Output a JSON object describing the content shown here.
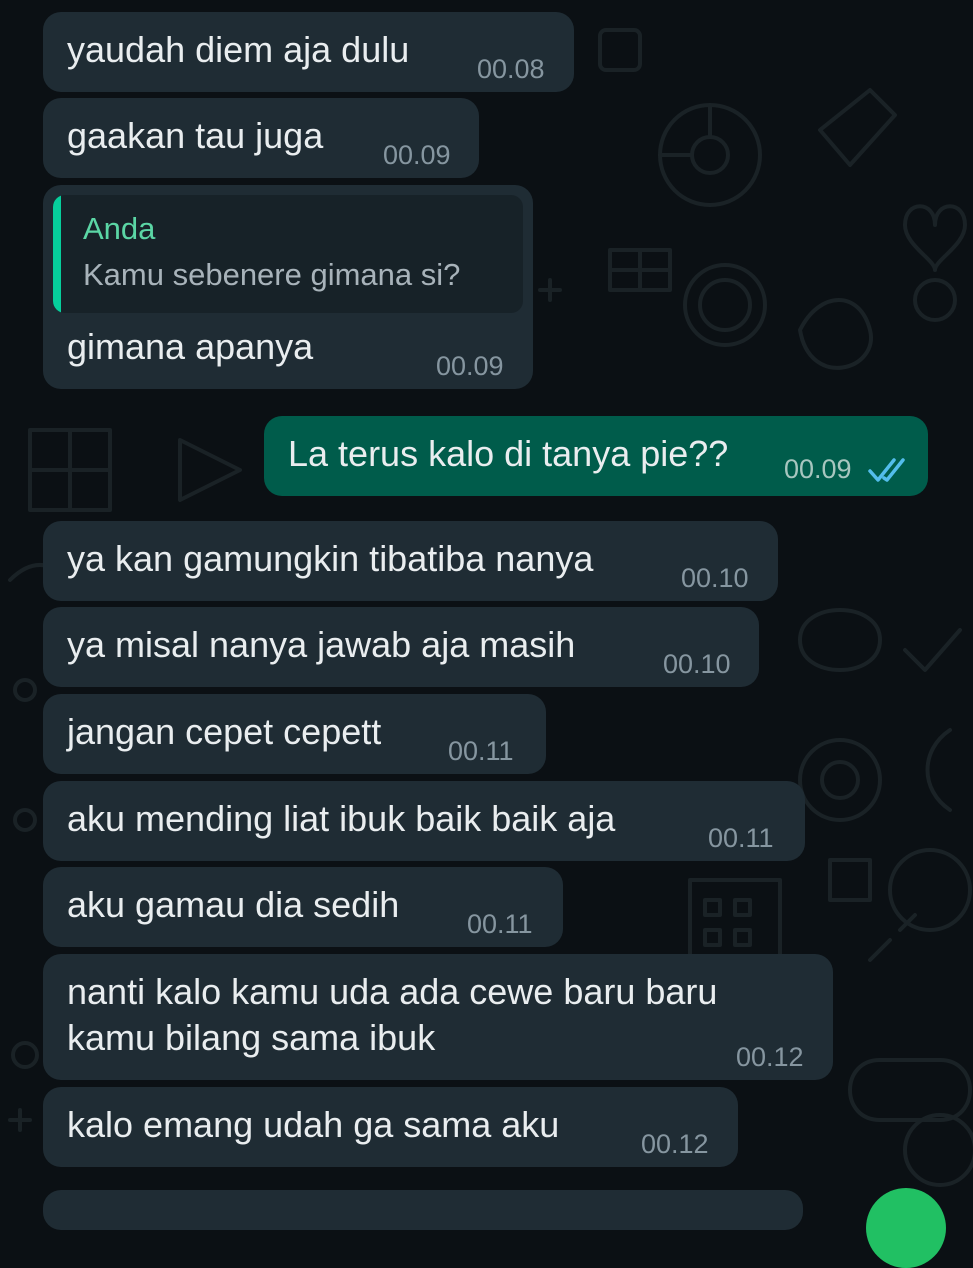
{
  "colors": {
    "background": "#0b1014",
    "incoming_bubble": "#1f2c34",
    "outgoing_bubble": "#005c4b",
    "quote_accent": "#06cf9c",
    "quote_sender": "#5bd6a5",
    "read_tick": "#53bdeb"
  },
  "messages": [
    {
      "direction": "incoming",
      "text": "yaudah diem aja dulu",
      "time": "00.08"
    },
    {
      "direction": "incoming",
      "text": "gaakan tau juga",
      "time": "00.09"
    },
    {
      "direction": "incoming",
      "text": "gimana apanya",
      "time": "00.09",
      "quote": {
        "sender": "Anda",
        "text": "Kamu sebenere gimana si?"
      }
    },
    {
      "direction": "outgoing",
      "text": "La terus kalo di tanya pie??",
      "time": "00.09",
      "status": "read",
      "status_icon": "double-check-icon"
    },
    {
      "direction": "incoming",
      "text": "ya kan gamungkin tibatiba nanya",
      "time": "00.10"
    },
    {
      "direction": "incoming",
      "text": "ya misal nanya jawab aja masih",
      "time": "00.10"
    },
    {
      "direction": "incoming",
      "text": "jangan cepet cepett",
      "time": "00.11"
    },
    {
      "direction": "incoming",
      "text": "aku mending liat ibuk baik baik aja",
      "time": "00.11"
    },
    {
      "direction": "incoming",
      "text": "aku gamau dia sedih",
      "time": "00.11"
    },
    {
      "direction": "incoming",
      "text_lines": [
        "nanti kalo kamu uda ada cewe baru baru",
        "kamu bilang sama ibuk"
      ],
      "time": "00.12"
    },
    {
      "direction": "incoming",
      "text": "kalo emang udah ga sama aku",
      "time": "00.12"
    }
  ],
  "fab_icon": "action-button-icon"
}
